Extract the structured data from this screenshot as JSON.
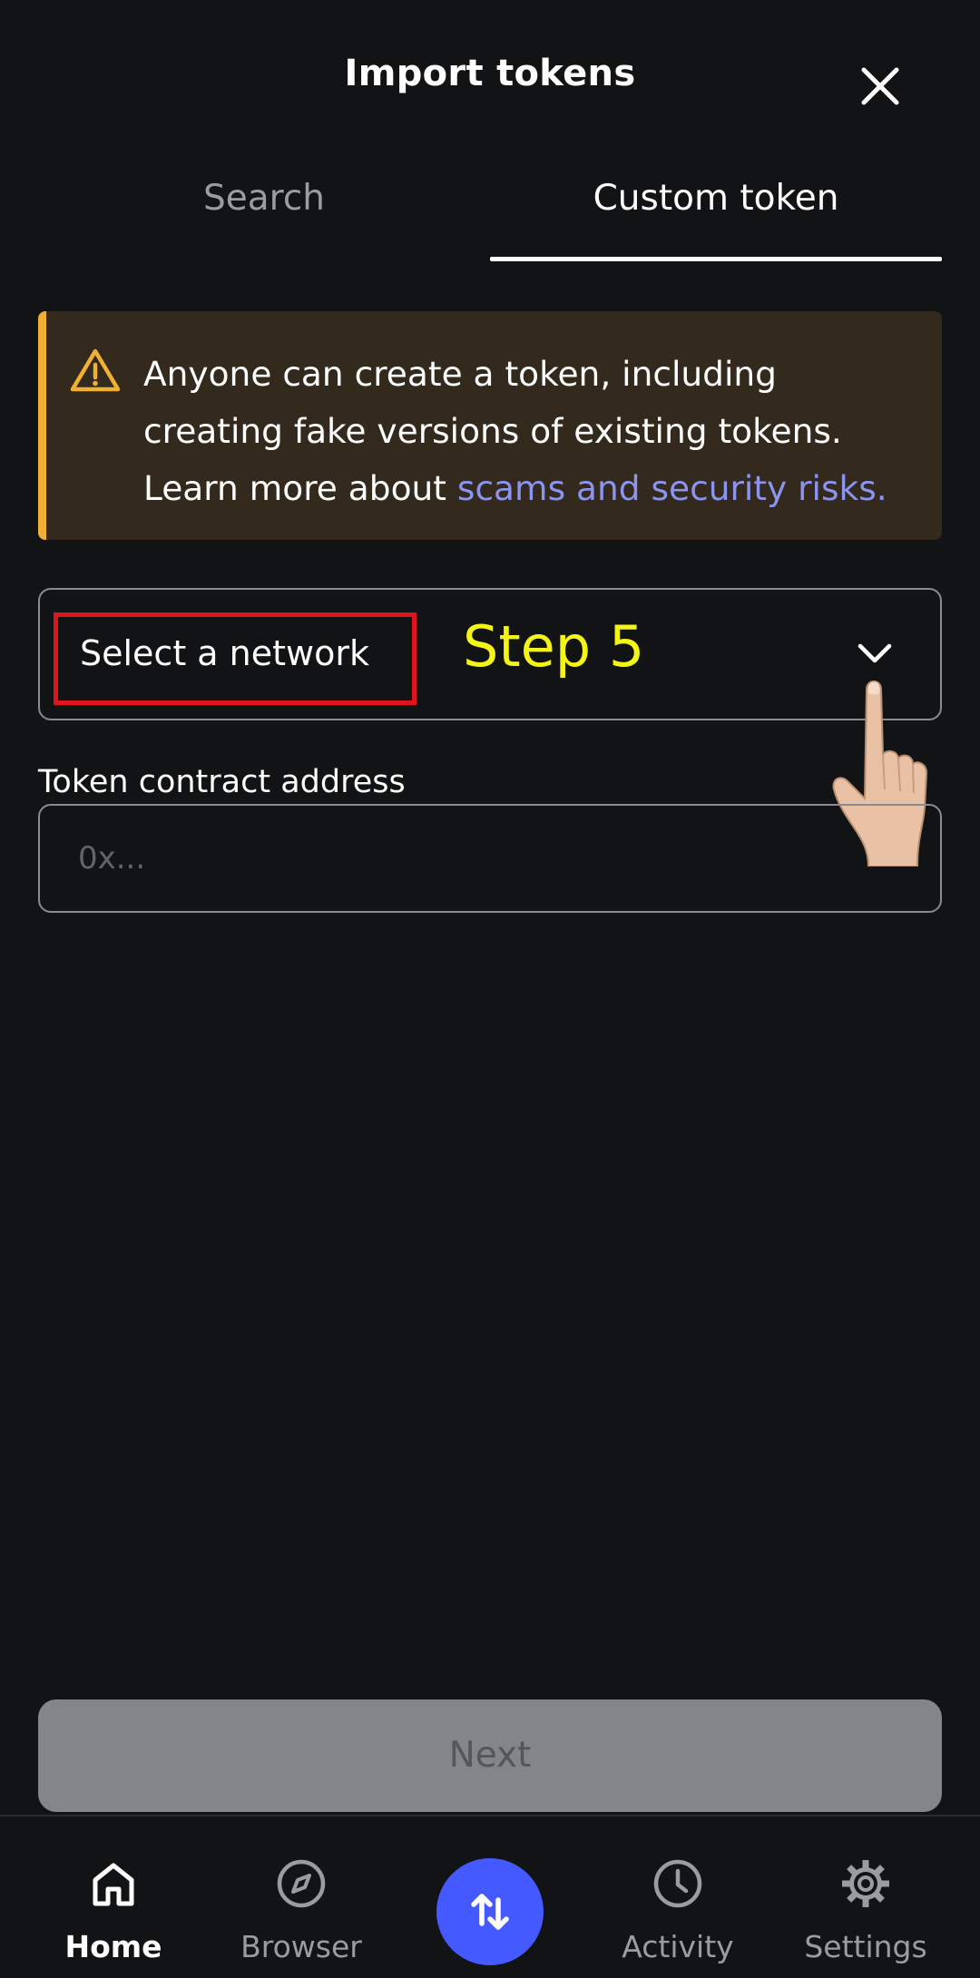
{
  "header": {
    "title": "Import tokens",
    "close_icon": "close-icon"
  },
  "tabs": [
    {
      "label": "Search",
      "active": false
    },
    {
      "label": "Custom token",
      "active": true
    }
  ],
  "warning": {
    "icon": "warning-icon",
    "text": "Anyone can create a token, including creating fake versions of existing tokens. Learn more about ",
    "link": "scams and security risks.",
    "accent_color": "#f0b034"
  },
  "network_select": {
    "label": "Select a network",
    "icon": "chevron-down-icon"
  },
  "annotation": {
    "step": "Step 5",
    "color": "#f4f417",
    "box_color": "#e2141b"
  },
  "token_address": {
    "label": "Token contract address",
    "placeholder": "0x...",
    "value": ""
  },
  "next_button": {
    "label": "Next",
    "enabled": false
  },
  "bottom_nav": {
    "items": [
      {
        "label": "Home",
        "icon": "home-icon",
        "active": true
      },
      {
        "label": "Browser",
        "icon": "compass-icon",
        "active": false
      },
      {
        "label": "Activity",
        "icon": "clock-icon",
        "active": false
      },
      {
        "label": "Settings",
        "icon": "gear-icon",
        "active": false
      }
    ],
    "center_button": {
      "icon": "swap-arrows-icon",
      "color": "#4459ff"
    }
  }
}
